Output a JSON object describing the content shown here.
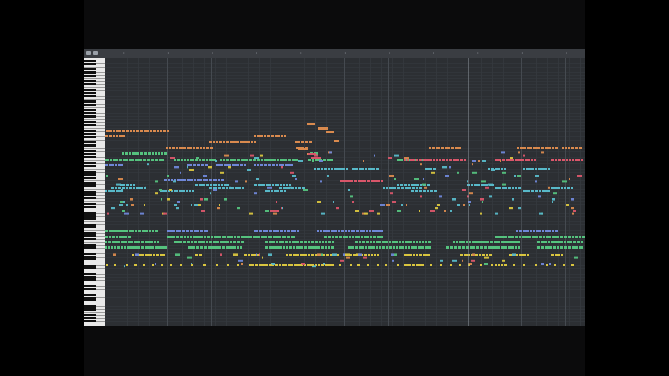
{
  "app": {
    "view": "piano-roll",
    "theme": {
      "background": "#2c2f33",
      "grid_line": "#363a3f",
      "bar_line": "#454a50",
      "ruler": "#3a3d42",
      "playhead": "#9aa3ab"
    }
  },
  "ruler": {
    "controls": [
      "zoom-icon",
      "snap-icon"
    ]
  },
  "keyboard": {
    "octaves": 9
  },
  "playhead": {
    "position_fraction": 0.75
  },
  "note_colors": {
    "orange": "#d98a4e",
    "red": "#d9566a",
    "green": "#55c27e",
    "blue": "#6f87d8",
    "cyan": "#58b9c9",
    "lime": "#9ac94a",
    "yellow": "#d9c53f"
  }
}
